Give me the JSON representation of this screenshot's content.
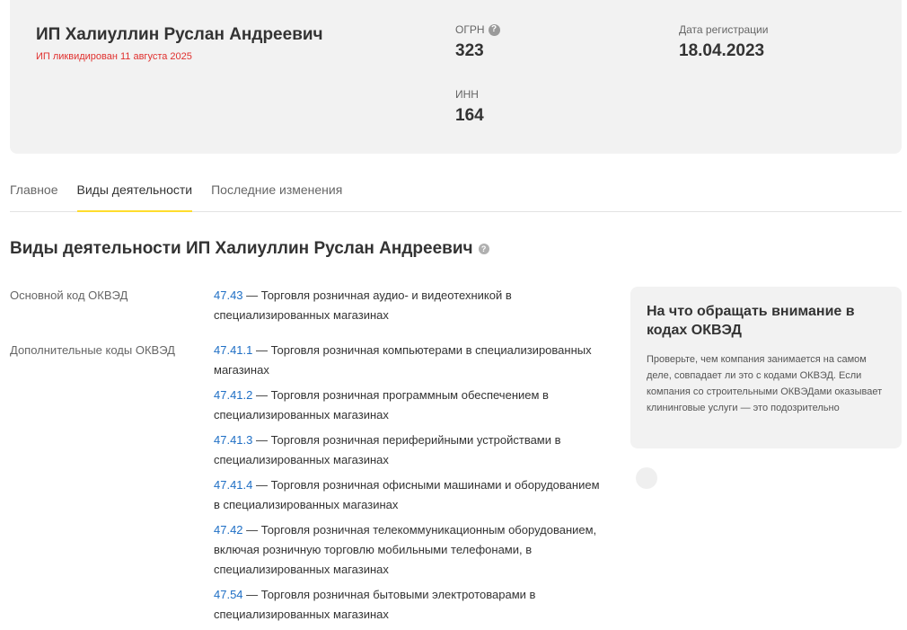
{
  "header": {
    "company_name": "ИП Халиуллин Руслан Андреевич",
    "status": "ИП ликвидирован 11 августа 2025",
    "ogrn_label": "ОГРН",
    "ogrn_value": "323",
    "inn_label": "ИНН",
    "inn_value": "164",
    "reg_date_label": "Дата регистрации",
    "reg_date_value": "18.04.2023"
  },
  "tabs": [
    {
      "label": "Главное",
      "active": false
    },
    {
      "label": "Виды деятельности",
      "active": true
    },
    {
      "label": "Последние изменения",
      "active": false
    }
  ],
  "section": {
    "title": "Виды деятельности ИП Халиуллин Руслан Андреевич"
  },
  "main_okved": {
    "label": "Основной код ОКВЭД",
    "code": "47.43",
    "description": " — Торговля розничная аудио- и видеотехникой в специализированных магазинах"
  },
  "additional_okved": {
    "label": "Дополнительные коды ОКВЭД",
    "items": [
      {
        "code": "47.41.1",
        "description": " — Торговля розничная компьютерами в специализированных магазинах"
      },
      {
        "code": "47.41.2",
        "description": " — Торговля розничная программным обеспечением в специализированных магазинах"
      },
      {
        "code": "47.41.3",
        "description": " — Торговля розничная периферийными устройствами в специализированных магазинах"
      },
      {
        "code": "47.41.4",
        "description": " — Торговля розничная офисными машинами и оборудованием в специализированных магазинах"
      },
      {
        "code": "47.42",
        "description": " — Торговля розничная телекоммуникационным оборудованием, включая розничную торговлю мобильными телефонами, в специализированных магазинах"
      },
      {
        "code": "47.54",
        "description": " — Торговля розничная бытовыми электротоварами в специализированных магазинах"
      }
    ]
  },
  "advice": {
    "title": "На что обращать внимание в кодах ОКВЭД",
    "text": "Проверьте, чем компания занимается на самом деле, совпадает ли это с кодами ОКВЭД. Если компания со строительными ОКВЭДами оказывает клининговые услуги — это подозрительно"
  },
  "colors": {
    "accent": "#ffdd2d",
    "link": "#1f6fc5",
    "status": "#e0302e",
    "card_bg": "#f2f2f2"
  },
  "icons": {
    "help": "question-circle-icon",
    "loader": "loading-dot-icon"
  }
}
